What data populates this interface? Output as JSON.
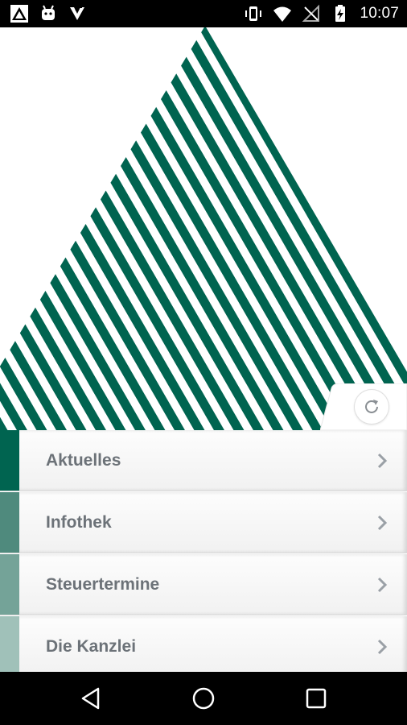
{
  "status_bar": {
    "time": "10:07",
    "icons": [
      "warning-icon",
      "android-debug-icon",
      "download-arrow-icon",
      "vibrate-icon",
      "wifi-icon",
      "no-signal-icon",
      "battery-charging-icon"
    ]
  },
  "hero": {
    "logo": "striped-triangle-logo",
    "colors": {
      "stripe": "#006450",
      "background": "#ffffff"
    }
  },
  "refresh": {
    "icon": "refresh-icon"
  },
  "menu": {
    "items": [
      {
        "label": "Aktuelles",
        "accent": "#006450"
      },
      {
        "label": "Infothek",
        "accent": "#4f8a7d"
      },
      {
        "label": "Steuertermine",
        "accent": "#74a398"
      },
      {
        "label": "Die Kanzlei",
        "accent": "#a0c1b9"
      }
    ],
    "chevron_icon": "chevron-right-icon",
    "label_color": "#6c7278"
  },
  "nav_bar": {
    "icons": [
      "back-icon",
      "home-icon",
      "recents-icon"
    ]
  }
}
